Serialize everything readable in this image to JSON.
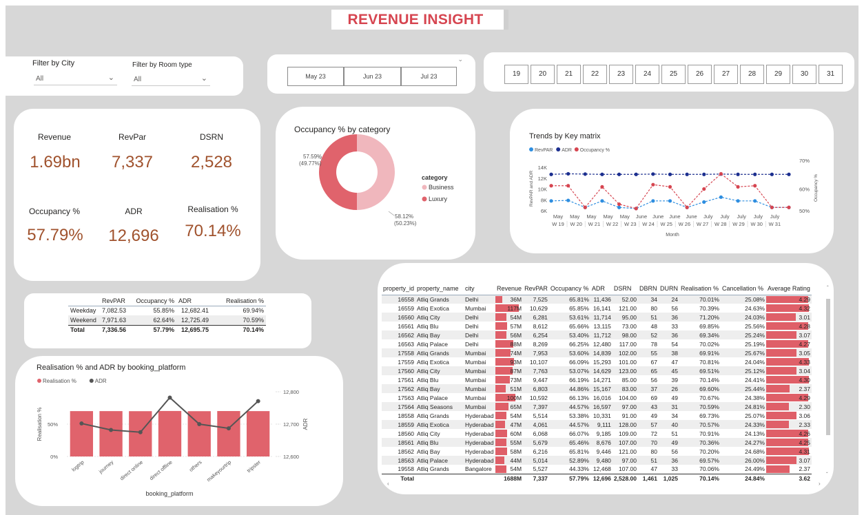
{
  "header": {
    "title": "REVENUE INSIGHT"
  },
  "filters": {
    "city_label": "Filter by City",
    "city_value": "All",
    "room_label": "Filter by Room type",
    "room_value": "All"
  },
  "months": [
    "May 23",
    "Jun 23",
    "Jul 23"
  ],
  "weeks": [
    "19",
    "20",
    "21",
    "22",
    "23",
    "24",
    "25",
    "26",
    "27",
    "28",
    "29",
    "30",
    "31"
  ],
  "kpis": {
    "revenue_label": "Revenue",
    "revenue_value": "1.69bn",
    "revpar_label": "RevPar",
    "revpar_value": "7,337",
    "dsrn_label": "DSRN",
    "dsrn_value": "2,528",
    "occ_label": "Occupancy %",
    "occ_value": "57.79%",
    "adr_label": "ADR",
    "adr_value": "12,696",
    "real_label": "Realisation %",
    "real_value": "70.14%"
  },
  "donut": {
    "title": "Occupancy % by category",
    "legend_title": "category",
    "slice1_pct": "57.59%",
    "slice1_share": "(49.77%)",
    "slice2_pct": "58.12%",
    "slice2_share": "(50.23%)",
    "legend": [
      {
        "label": "Business",
        "color": "#f0b7bd"
      },
      {
        "label": "Luxury",
        "color": "#e0636c"
      }
    ]
  },
  "weekday_table": {
    "headers": [
      "",
      "RevPAR",
      "Occupancy %",
      "ADR",
      "Realisation %"
    ],
    "rows": [
      [
        "Weekday",
        "7,082.53",
        "55.85%",
        "12,682.41",
        "69.94%"
      ],
      [
        "Weekend",
        "7,971.63",
        "62.64%",
        "12,725.49",
        "70.59%"
      ],
      [
        "Total",
        "7,336.56",
        "57.79%",
        "12,695.75",
        "70.14%"
      ]
    ]
  },
  "property_table": {
    "headers": [
      "property_id",
      "property_name",
      "city",
      "Revenue",
      "RevPAR",
      "Occupancy %",
      "ADR",
      "DSRN",
      "DBRN",
      "DURN",
      "Realisation %",
      "Cancellation %",
      "Average Rating"
    ],
    "rows": [
      [
        "16558",
        "Atliq Grands",
        "Delhi",
        "36M",
        "7,525",
        "65.81%",
        "11,436",
        "52.00",
        "34",
        "24",
        "70.01%",
        "25.08%",
        "4.29"
      ],
      [
        "16559",
        "Atliq Exotica",
        "Mumbai",
        "117M",
        "10,629",
        "65.85%",
        "16,141",
        "121.00",
        "80",
        "56",
        "70.39%",
        "24.63%",
        "4.32"
      ],
      [
        "16560",
        "Atliq City",
        "Delhi",
        "54M",
        "6,281",
        "53.61%",
        "11,714",
        "95.00",
        "51",
        "36",
        "71.20%",
        "24.03%",
        "3.01"
      ],
      [
        "16561",
        "Atliq Blu",
        "Delhi",
        "57M",
        "8,612",
        "65.66%",
        "13,115",
        "73.00",
        "48",
        "33",
        "69.85%",
        "25.56%",
        "4.28"
      ],
      [
        "16562",
        "Atliq Bay",
        "Delhi",
        "56M",
        "6,254",
        "53.40%",
        "11,712",
        "98.00",
        "52",
        "36",
        "69.34%",
        "25.24%",
        "3.07"
      ],
      [
        "16563",
        "Atliq Palace",
        "Delhi",
        "88M",
        "8,269",
        "66.25%",
        "12,480",
        "117.00",
        "78",
        "54",
        "70.02%",
        "25.19%",
        "4.27"
      ],
      [
        "17558",
        "Atliq Grands",
        "Mumbai",
        "74M",
        "7,953",
        "53.60%",
        "14,839",
        "102.00",
        "55",
        "38",
        "69.91%",
        "25.67%",
        "3.05"
      ],
      [
        "17559",
        "Atliq Exotica",
        "Mumbai",
        "93M",
        "10,107",
        "66.09%",
        "15,293",
        "101.00",
        "67",
        "47",
        "70.81%",
        "24.04%",
        "4.33"
      ],
      [
        "17560",
        "Atliq City",
        "Mumbai",
        "87M",
        "7,763",
        "53.07%",
        "14,629",
        "123.00",
        "65",
        "45",
        "69.51%",
        "25.12%",
        "3.04"
      ],
      [
        "17561",
        "Atliq Blu",
        "Mumbai",
        "73M",
        "9,447",
        "66.19%",
        "14,271",
        "85.00",
        "56",
        "39",
        "70.14%",
        "24.41%",
        "4.30"
      ],
      [
        "17562",
        "Atliq Bay",
        "Mumbai",
        "51M",
        "6,803",
        "44.86%",
        "15,167",
        "83.00",
        "37",
        "26",
        "69.60%",
        "25.44%",
        "2.37"
      ],
      [
        "17563",
        "Atliq Palace",
        "Mumbai",
        "100M",
        "10,592",
        "66.13%",
        "16,016",
        "104.00",
        "69",
        "49",
        "70.67%",
        "24.38%",
        "4.29"
      ],
      [
        "17564",
        "Atliq Seasons",
        "Mumbai",
        "65M",
        "7,397",
        "44.57%",
        "16,597",
        "97.00",
        "43",
        "31",
        "70.59%",
        "24.81%",
        "2.30"
      ],
      [
        "18558",
        "Atliq Grands",
        "Hyderabad",
        "54M",
        "5,514",
        "53.38%",
        "10,331",
        "91.00",
        "49",
        "34",
        "69.73%",
        "25.07%",
        "3.06"
      ],
      [
        "18559",
        "Atliq Exotica",
        "Hyderabad",
        "47M",
        "4,061",
        "44.57%",
        "9,111",
        "128.00",
        "57",
        "40",
        "70.57%",
        "24.33%",
        "2.33"
      ],
      [
        "18560",
        "Atliq City",
        "Hyderabad",
        "60M",
        "6,068",
        "66.07%",
        "9,185",
        "109.00",
        "72",
        "51",
        "70.91%",
        "24.13%",
        "4.26"
      ],
      [
        "18561",
        "Atliq Blu",
        "Hyderabad",
        "55M",
        "5,679",
        "65.46%",
        "8,676",
        "107.00",
        "70",
        "49",
        "70.36%",
        "24.27%",
        "4.25"
      ],
      [
        "18562",
        "Atliq Bay",
        "Hyderabad",
        "58M",
        "6,216",
        "65.81%",
        "9,446",
        "121.00",
        "80",
        "56",
        "70.20%",
        "24.68%",
        "4.31"
      ],
      [
        "18563",
        "Atliq Palace",
        "Hyderabad",
        "44M",
        "5,014",
        "52.89%",
        "9,480",
        "97.00",
        "51",
        "36",
        "69.57%",
        "26.00%",
        "3.07"
      ],
      [
        "19558",
        "Atliq Grands",
        "Bangalore",
        "54M",
        "5,527",
        "44.33%",
        "12,468",
        "107.00",
        "47",
        "33",
        "70.06%",
        "24.49%",
        "2.37"
      ]
    ],
    "total": [
      "Total",
      "",
      "",
      "1688M",
      "7,337",
      "57.79%",
      "12,696",
      "2,528.00",
      "1,461",
      "1,025",
      "70.14%",
      "24.84%",
      "3.62"
    ]
  },
  "chart_data": [
    {
      "type": "line",
      "title": "Trends by Key matrix",
      "xlabel": "Month",
      "ylabel": "RevPAR and ADR",
      "y2label": "Occupancy %",
      "categories": [
        "May W 19",
        "May W 20",
        "May W 21",
        "May W 22",
        "May W 23",
        "June W 23",
        "June W 24",
        "June W 25",
        "June W 26",
        "June W 27",
        "July W 27",
        "July W 28",
        "July W 29",
        "July W 30",
        "July W 31"
      ],
      "tick_top": [
        "May",
        "May",
        "May",
        "May",
        "May",
        "June",
        "June",
        "June",
        "June",
        "July",
        "July",
        "July",
        "July",
        "July"
      ],
      "tick_bottom": [
        "W 19",
        "W 20",
        "W 21",
        "W 22",
        "W 23",
        "W 24",
        "W 25",
        "W 26",
        "W 27",
        "W 28",
        "W 29",
        "W 30",
        "W 31"
      ],
      "yticks": [
        "6K",
        "8K",
        "10K",
        "12K",
        "14K"
      ],
      "y2ticks": [
        "50%",
        "60%",
        "70%"
      ],
      "ylim": [
        6000,
        14000
      ],
      "y2lim": [
        50,
        70
      ],
      "series": [
        {
          "name": "RevPAR",
          "color": "#2e8ee0",
          "axis": "left",
          "values": [
            7800,
            7900,
            6600,
            7800,
            6600,
            6400,
            7800,
            7800,
            6600,
            7600,
            8500,
            7800,
            7800,
            6600,
            6600
          ]
        },
        {
          "name": "ADR",
          "color": "#1c2f8f",
          "axis": "left",
          "values": [
            12700,
            12800,
            12750,
            12700,
            12700,
            12700,
            12750,
            12700,
            12700,
            12700,
            12750,
            12700,
            12700,
            12700,
            12700
          ]
        },
        {
          "name": "Occupancy %",
          "color": "#d64550",
          "axis": "right",
          "values": [
            61.5,
            61.5,
            51.5,
            61,
            53,
            51,
            62,
            61,
            51.5,
            60,
            67,
            61,
            61.5,
            51.5,
            51.5
          ]
        }
      ]
    },
    {
      "type": "bar",
      "title": "Realisation % and ADR by booking_platform",
      "xlabel": "booking_platform",
      "ylabel": "Realisation %",
      "y2label": "ADR",
      "categories": [
        "logtrip",
        "journey",
        "direct online",
        "direct offline",
        "others",
        "makeyourtrip",
        "tripster"
      ],
      "yticks": [
        "0%",
        "50%"
      ],
      "y2ticks": [
        "12,600",
        "12,700",
        "12,800"
      ],
      "ylim": [
        0,
        100
      ],
      "y2lim": [
        12600,
        12800
      ],
      "series": [
        {
          "name": "Realisation %",
          "color": "#e0636c",
          "type": "bar",
          "values": [
            70.1,
            70.1,
            70.0,
            70.3,
            70.0,
            70.2,
            70.1
          ]
        },
        {
          "name": "ADR",
          "color": "#555555",
          "type": "line",
          "values": [
            12702,
            12682,
            12675,
            12782,
            12700,
            12687,
            12771
          ]
        }
      ]
    }
  ]
}
